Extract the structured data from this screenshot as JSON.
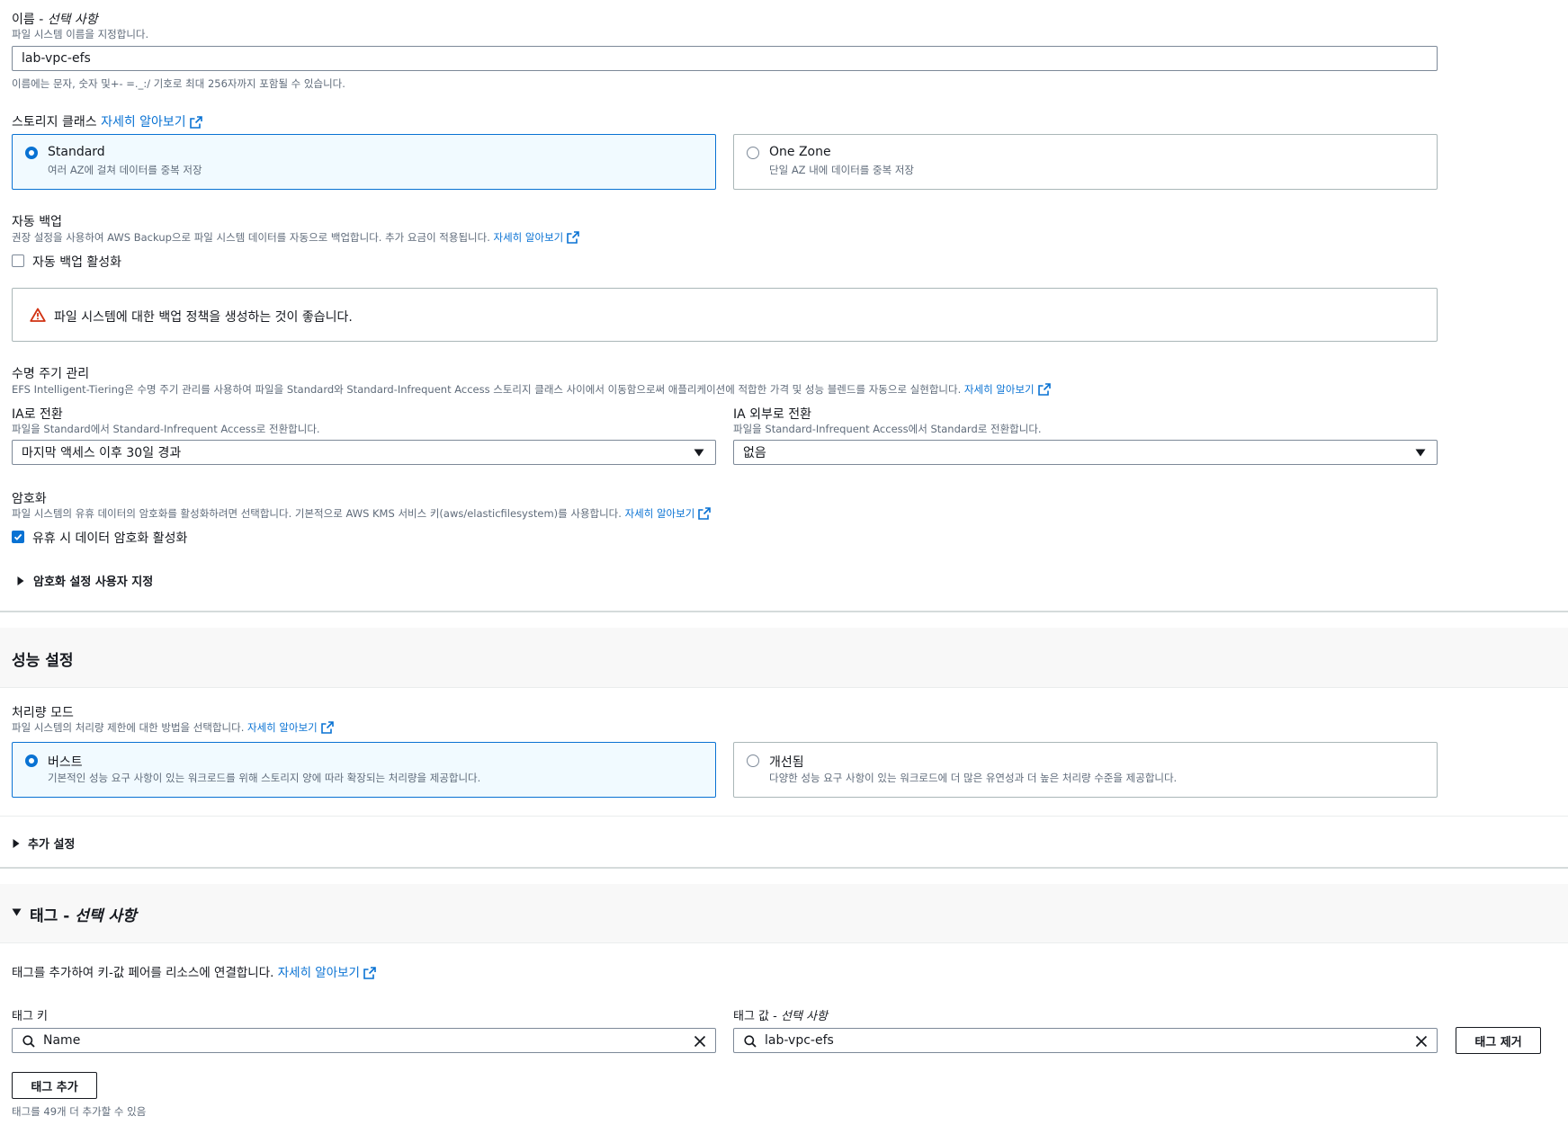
{
  "name": {
    "label": "이름",
    "optional": "선택 사항",
    "sep": " - ",
    "desc": "파일 시스템 이름을 지정합니다.",
    "value": "lab-vpc-efs",
    "hint": "이름에는 문자, 숫자 및+- =._:/ 기호로 최대 256자까지 포함될 수 있습니다."
  },
  "storage_class": {
    "label": "스토리지 클래스",
    "learn_more": "자세히 알아보기",
    "options": [
      {
        "title": "Standard",
        "desc": "여러 AZ에 걸쳐 데이터를 중복 저장",
        "selected": true
      },
      {
        "title": "One Zone",
        "desc": "단일 AZ 내에 데이터를 중복 저장",
        "selected": false
      }
    ]
  },
  "backup": {
    "label": "자동 백업",
    "desc": "권장 설정을 사용하여 AWS Backup으로 파일 시스템 데이터를 자동으로 백업합니다. 추가 요금이 적용됩니다.",
    "learn_more": "자세히 알아보기",
    "checkbox_label": "자동 백업 활성화",
    "checked": false,
    "warning": "파일 시스템에 대한 백업 정책을 생성하는 것이 좋습니다."
  },
  "lifecycle": {
    "label": "수명 주기 관리",
    "desc": "EFS Intelligent-Tiering은 수명 주기 관리를 사용하여 파일을 Standard와 Standard-Infrequent Access 스토리지 클래스 사이에서 이동함으로써 애플리케이션에 적합한 가격 및 성능 블렌드를 자동으로 실현합니다.",
    "learn_more": "자세히 알아보기",
    "to_ia": {
      "label": "IA로 전환",
      "desc": "파일을 Standard에서 Standard-Infrequent Access로 전환합니다.",
      "value": "마지막 액세스 이후 30일 경과"
    },
    "from_ia": {
      "label": "IA 외부로 전환",
      "desc": "파일을 Standard-Infrequent Access에서 Standard로 전환합니다.",
      "value": "없음"
    }
  },
  "encryption": {
    "label": "암호화",
    "desc": "파일 시스템의 유휴 데이터의 암호화를 활성화하려면 선택합니다. 기본적으로 AWS KMS 서비스 키(aws/elasticfilesystem)를 사용합니다.",
    "learn_more": "자세히 알아보기",
    "checkbox_label": "유휴 시 데이터 암호화 활성화",
    "checked": true,
    "customize": "암호화 설정 사용자 지정"
  },
  "performance": {
    "heading": "성능 설정",
    "throughput_label": "처리량 모드",
    "throughput_desc": "파일 시스템의 처리량 제한에 대한 방법을 선택합니다.",
    "learn_more": "자세히 알아보기",
    "options": [
      {
        "title": "버스트",
        "desc": "기본적인 성능 요구 사항이 있는 워크로드를 위해 스토리지 양에 따라 확장되는 처리량을 제공합니다.",
        "selected": true
      },
      {
        "title": "개선됨",
        "desc": "다양한 성능 요구 사항이 있는 워크로드에 더 많은 유연성과 더 높은 처리량 수준을 제공합니다.",
        "selected": false
      }
    ],
    "additional": "추가 설정"
  },
  "tags": {
    "heading": "태그",
    "heading_optional": "선택 사항",
    "sep": " - ",
    "desc": "태그를 추가하여 키-값 페어를 리소스에 연결합니다.",
    "learn_more": "자세히 알아보기",
    "key_label": "태그 키",
    "value_label": "태그 값",
    "value_optional": "선택 사항",
    "key_value": "Name",
    "value_value": "lab-vpc-efs",
    "remove_button": "태그 제거",
    "add_button": "태그 추가",
    "limit_hint": "태그를 49개 더 추가할 수 있음"
  }
}
